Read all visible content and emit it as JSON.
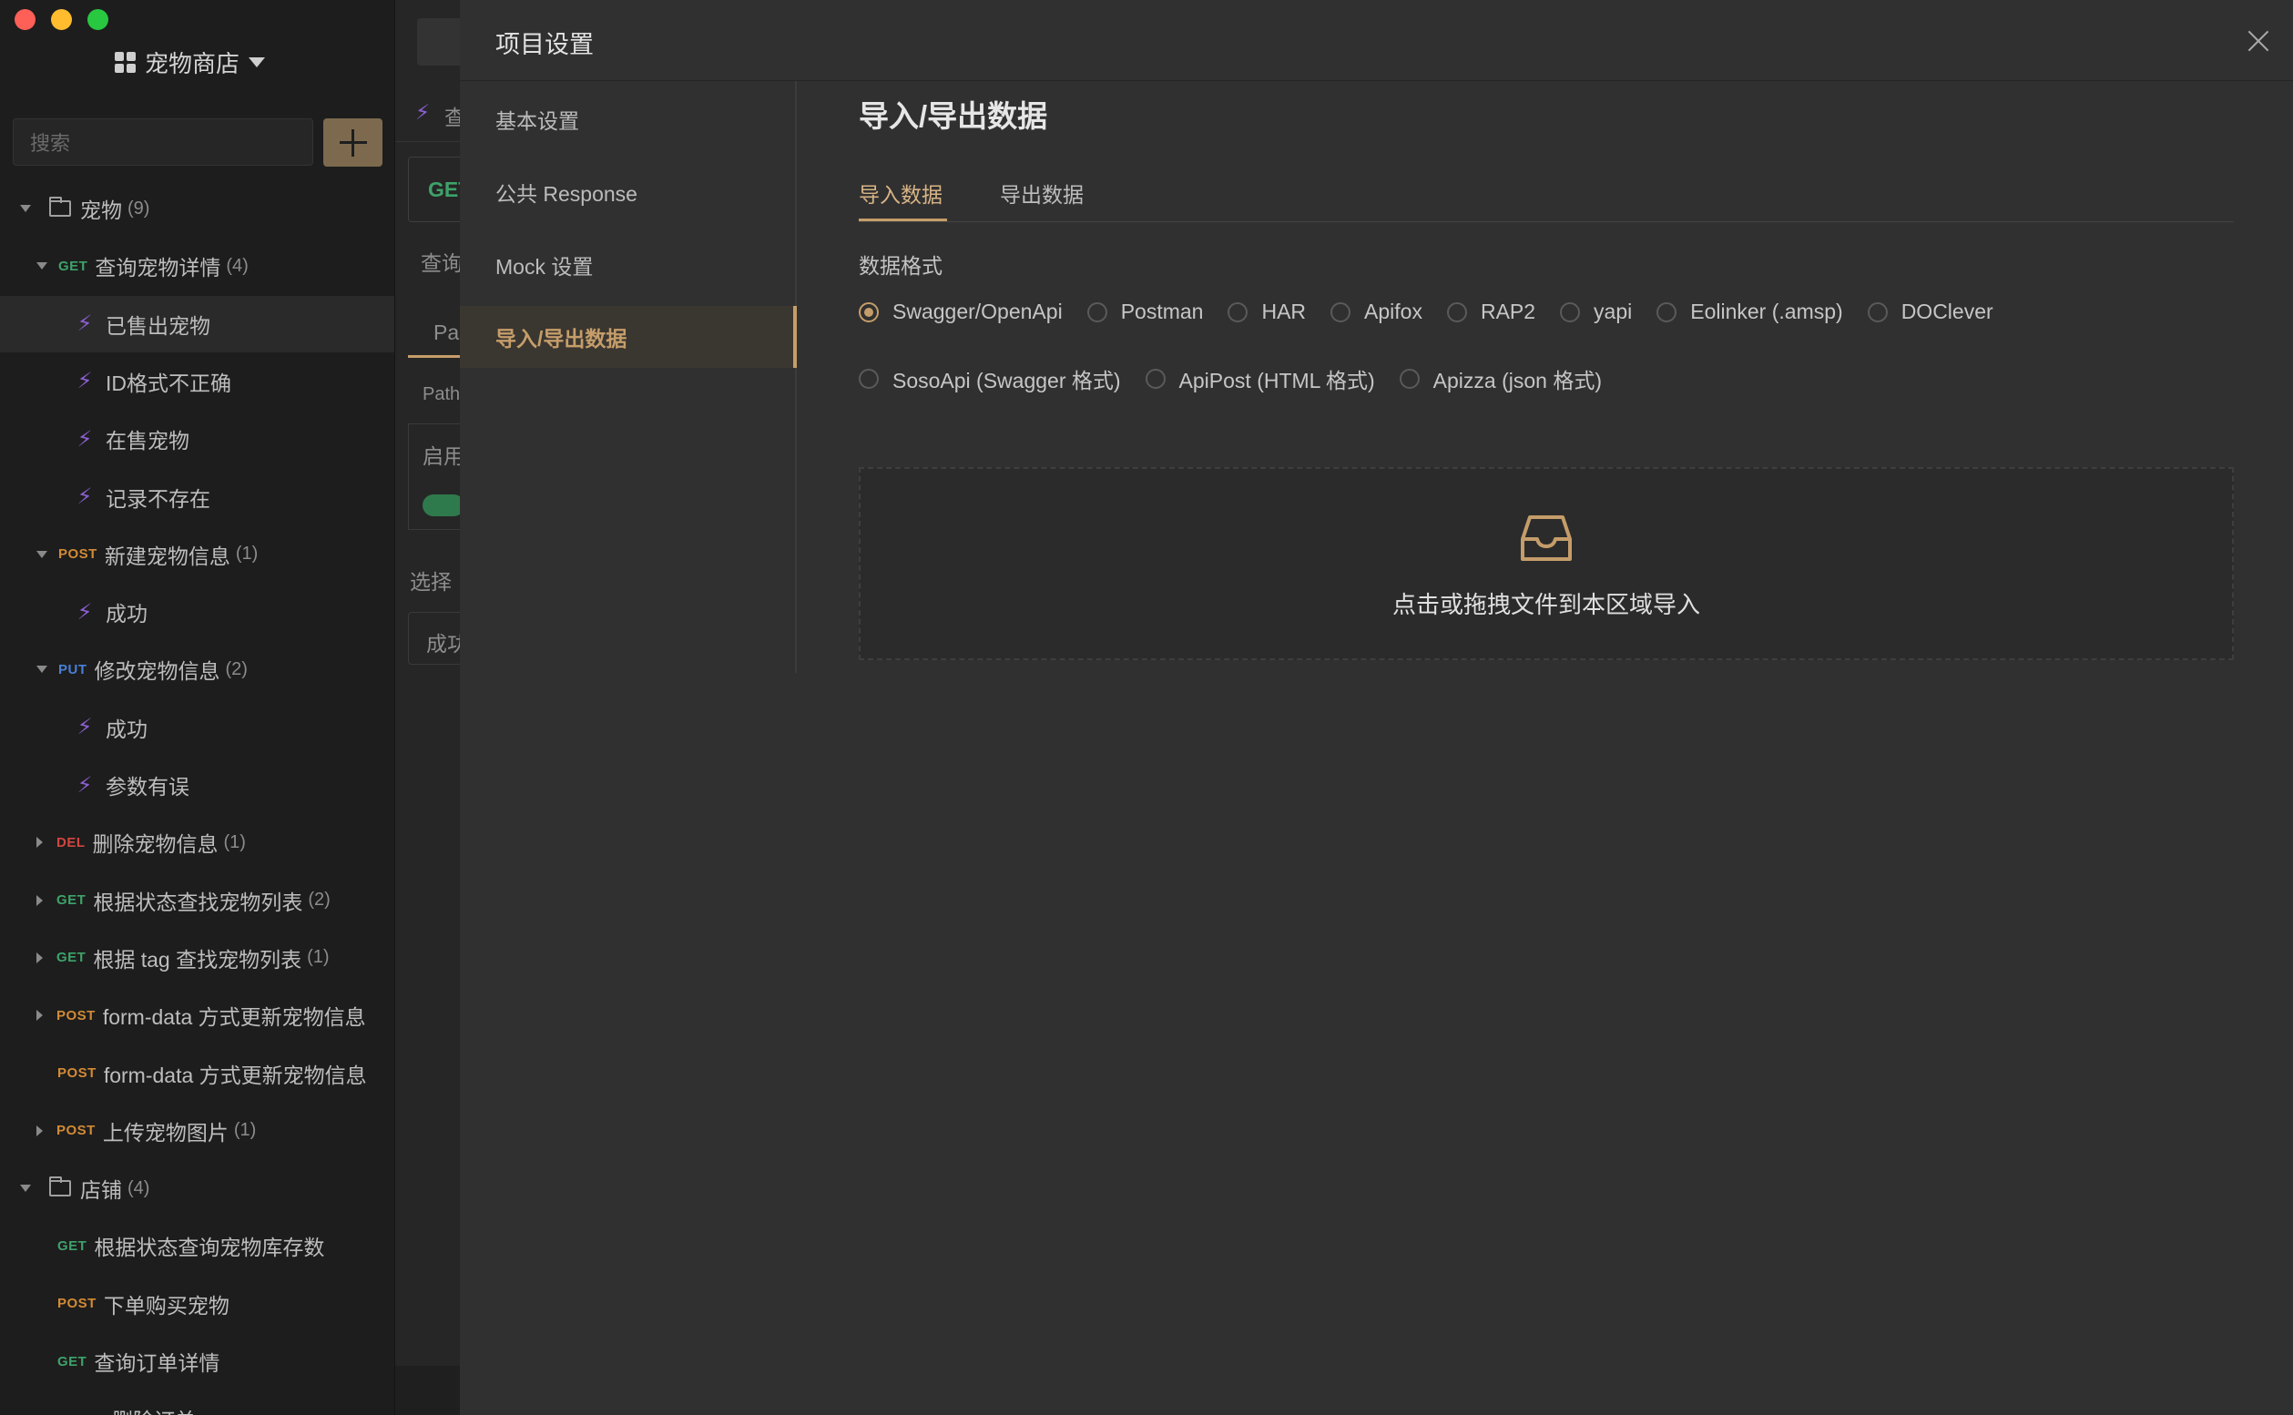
{
  "sidebar": {
    "project_name": "宠物商店",
    "search_placeholder": "搜索",
    "tree": [
      {
        "kind": "folder",
        "label": "宠物",
        "count": "(9)"
      },
      {
        "kind": "endpoint",
        "method": "GET",
        "label": "查询宠物详情",
        "count": "(4)",
        "expanded": true
      },
      {
        "kind": "case",
        "label": "已售出宠物",
        "selected": true
      },
      {
        "kind": "case",
        "label": "ID格式不正确"
      },
      {
        "kind": "case",
        "label": "在售宠物"
      },
      {
        "kind": "case",
        "label": "记录不存在"
      },
      {
        "kind": "endpoint",
        "method": "POST",
        "label": "新建宠物信息",
        "count": "(1)",
        "expanded": true
      },
      {
        "kind": "case",
        "label": "成功"
      },
      {
        "kind": "endpoint",
        "method": "PUT",
        "label": "修改宠物信息",
        "count": "(2)",
        "expanded": true
      },
      {
        "kind": "case",
        "label": "成功"
      },
      {
        "kind": "case",
        "label": "参数有误"
      },
      {
        "kind": "endpoint",
        "method": "DEL",
        "label": "删除宠物信息",
        "count": "(1)",
        "expanded": false
      },
      {
        "kind": "endpoint",
        "method": "GET",
        "label": "根据状态查找宠物列表",
        "count": "(2)",
        "expanded": false
      },
      {
        "kind": "endpoint",
        "method": "GET",
        "label": "根据 tag 查找宠物列表",
        "count": "(1)",
        "expanded": false
      },
      {
        "kind": "endpoint",
        "method": "POST",
        "label": "form-data 方式更新宠物信息",
        "count": "",
        "expanded": false
      },
      {
        "kind": "endpoint",
        "method": "POST",
        "label": "form-data 方式更新宠物信息",
        "count": "",
        "leaf": true
      },
      {
        "kind": "endpoint",
        "method": "POST",
        "label": "上传宠物图片",
        "count": "(1)",
        "expanded": false
      },
      {
        "kind": "folder",
        "label": "店铺",
        "count": "(4)"
      },
      {
        "kind": "endpoint",
        "method": "GET",
        "label": "根据状态查询宠物库存数",
        "count": "",
        "leaf": true
      },
      {
        "kind": "endpoint",
        "method": "POST",
        "label": "下单购买宠物",
        "count": "",
        "leaf": true
      },
      {
        "kind": "endpoint",
        "method": "GET",
        "label": "查询订单详情",
        "count": "",
        "leaf": true
      },
      {
        "kind": "endpoint",
        "method": "",
        "label": "删除订单",
        "count": "",
        "leaf": true
      }
    ]
  },
  "middle": {
    "fragments": [
      "查",
      "GET",
      "查询",
      "Pa",
      "Path",
      "启用",
      "选择",
      "成功"
    ]
  },
  "modal": {
    "title": "项目设置",
    "nav": [
      "基本设置",
      "公共 Response",
      "Mock 设置",
      "导入/导出数据"
    ],
    "active_nav": "导入/导出数据",
    "content_title": "导入/导出数据",
    "tabs": [
      "导入数据",
      "导出数据"
    ],
    "active_tab": "导入数据",
    "format_label": "数据格式",
    "formats_row1": [
      "Swagger/OpenApi",
      "Postman",
      "HAR",
      "Apifox",
      "RAP2",
      "yapi",
      "Eolinker (.amsp)",
      "DOClever"
    ],
    "formats_row2": [
      "SosoApi (Swagger 格式)",
      "ApiPost (HTML 格式)",
      "Apizza (json 格式)"
    ],
    "selected_format": "Swagger/OpenApi",
    "upload_text": "点击或拖拽文件到本区域导入"
  },
  "colors": {
    "accent": "#c59d6a",
    "get": "#3ea26a",
    "post": "#d28a35",
    "put": "#4a7fd6",
    "del": "#d2453f"
  }
}
